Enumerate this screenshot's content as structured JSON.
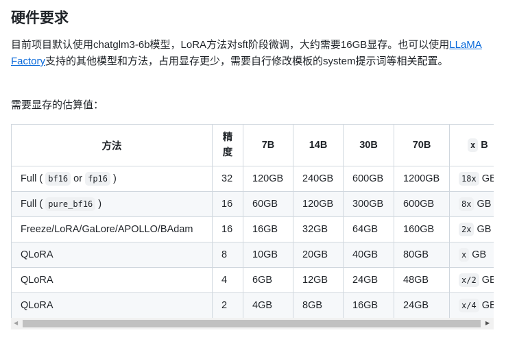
{
  "title": "硬件要求",
  "para1_a": "目前项目默认使用chatglm3-6b模型，LoRA方法对sft阶段微调，大约需要16GB显存。也可以使用",
  "link": "LLaMA Factory",
  "para1_b": "支持的其他模型和方法，占用显存更少，需要自行修改模板的system提示词等相关配置。",
  "para2": "需要显存的估算值：",
  "table": {
    "headers": [
      "方法",
      "精度",
      "7B",
      "14B",
      "30B",
      "70B",
      "x B"
    ],
    "rows": [
      {
        "method": [
          "Full (",
          "bf16",
          "or",
          "fp16",
          ")"
        ],
        "cells": [
          "32",
          "120GB",
          "240GB",
          "600GB",
          "1200GB"
        ],
        "x": [
          "18x",
          "GB"
        ]
      },
      {
        "method": [
          "Full (",
          "pure_bf16",
          ")"
        ],
        "cells": [
          "16",
          "60GB",
          "120GB",
          "300GB",
          "600GB"
        ],
        "x": [
          "8x",
          "GB"
        ]
      },
      {
        "method": [
          "Freeze/LoRA/GaLore/APOLLO/BAdam"
        ],
        "cells": [
          "16",
          "16GB",
          "32GB",
          "64GB",
          "160GB"
        ],
        "x": [
          "2x",
          "GB"
        ]
      },
      {
        "method": [
          "QLoRA"
        ],
        "cells": [
          "8",
          "10GB",
          "20GB",
          "40GB",
          "80GB"
        ],
        "x": [
          "x",
          "GB"
        ]
      },
      {
        "method": [
          "QLoRA"
        ],
        "cells": [
          "4",
          "6GB",
          "12GB",
          "24GB",
          "48GB"
        ],
        "x": [
          "x/2",
          "GB"
        ]
      },
      {
        "method": [
          "QLoRA"
        ],
        "cells": [
          "2",
          "4GB",
          "8GB",
          "16GB",
          "24GB"
        ],
        "x": [
          "x/4",
          "GB"
        ]
      }
    ]
  }
}
